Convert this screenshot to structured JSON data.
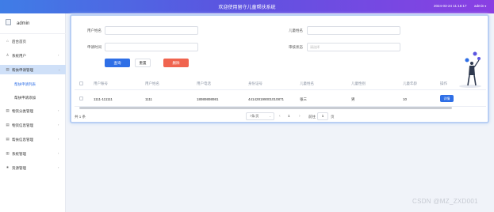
{
  "topbar": {
    "title": "欢迎使用留守儿童帮扶系统",
    "datetime": "2024-03-24 11:16:17",
    "user": "admin",
    "user_caret": "▾",
    "colors": {
      "start": "#3f7de6",
      "end": "#8a3fe3"
    }
  },
  "sidebar": {
    "username": "admin",
    "items": [
      {
        "label": "后台首页",
        "icon": "home-icon",
        "glyph": "⌂"
      },
      {
        "label": "系统用户",
        "icon": "user-icon",
        "glyph": "♙",
        "arrow": "›"
      },
      {
        "label": "帮扶申请管理",
        "icon": "doc-icon",
        "glyph": "▤",
        "arrow": "⌄"
      },
      {
        "label": "帮扶申请列表"
      },
      {
        "label": "帮扶申请添加"
      },
      {
        "label": "物资分类管理",
        "icon": "doc-icon",
        "glyph": "▤",
        "arrow": "›"
      },
      {
        "label": "物资信息管理",
        "icon": "doc-icon",
        "glyph": "▤",
        "arrow": "›"
      },
      {
        "label": "帮扶信息管理",
        "icon": "doc-icon",
        "glyph": "▤",
        "arrow": "›"
      },
      {
        "label": "系统管理",
        "icon": "settings-icon",
        "glyph": "▥",
        "arrow": "›"
      },
      {
        "label": "资源管理",
        "icon": "gear-icon",
        "glyph": "✷",
        "arrow": "›"
      }
    ]
  },
  "search": {
    "field1_label": "用户姓名",
    "field2_label": "儿童姓名",
    "field3_label": "申请时间",
    "field4_label": "审核状态",
    "field4_placeholder": "请选择",
    "search_button": "查询",
    "reset_button": "重置",
    "delete_button": "删除"
  },
  "table": {
    "columns": [
      "用户账号",
      "用户姓名",
      "用户电话",
      "身份证号",
      "儿童姓名",
      "儿童性别",
      "儿童年龄",
      "操作"
    ],
    "rows": [
      {
        "account": "1111-111111",
        "name": "1111",
        "phone": "18989898981",
        "id": "441428199001010871",
        "child": "张三",
        "gender": "男",
        "age": "10",
        "action": "详情"
      }
    ]
  },
  "pager": {
    "total": "共 1 条",
    "size": "7条/页",
    "prev": "‹",
    "page": "1",
    "next": "›",
    "goto": "前往",
    "goto_value": "1",
    "page_suffix": "页"
  },
  "watermark": "CSDN @MZ_ZXD001"
}
